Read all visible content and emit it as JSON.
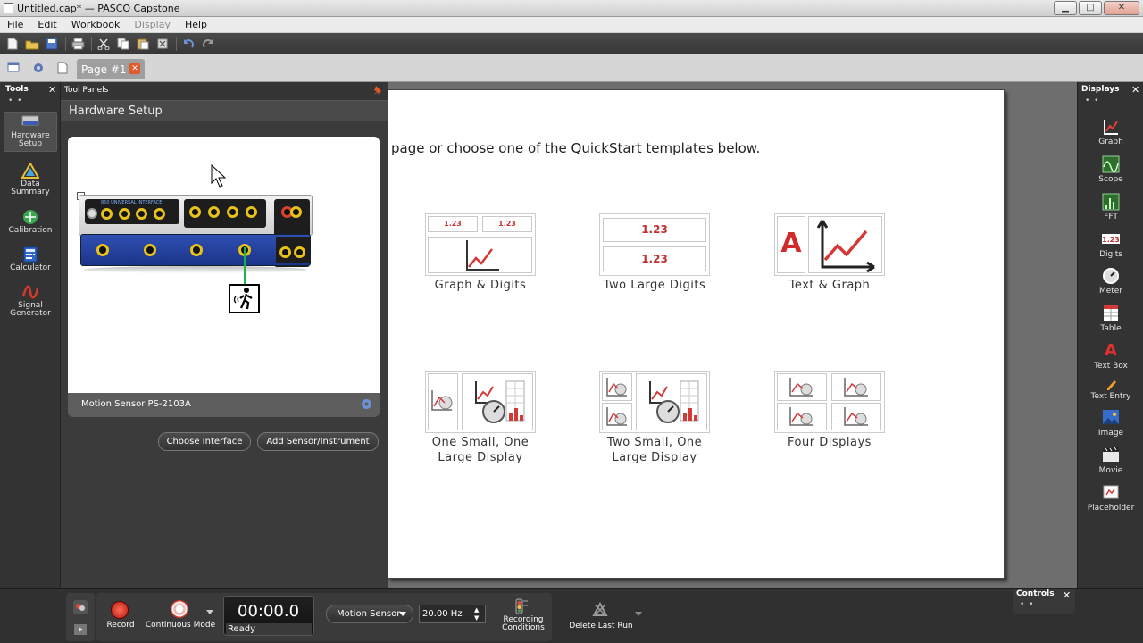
{
  "window": {
    "title": "Untitled.cap* — PASCO Capstone",
    "min": "▁",
    "max": "□",
    "close": "✕"
  },
  "menu": [
    {
      "label": "File",
      "enabled": true
    },
    {
      "label": "Edit",
      "enabled": true
    },
    {
      "label": "Workbook",
      "enabled": true
    },
    {
      "label": "Display",
      "enabled": false
    },
    {
      "label": "Help",
      "enabled": true
    }
  ],
  "tabs": {
    "active": "Page #1",
    "close": "✕"
  },
  "tools": {
    "title": "Tools",
    "close": "✕",
    "dots": "• •",
    "items": [
      {
        "label": "Hardware Setup",
        "icon": "hardware-icon"
      },
      {
        "label": "Data Summary",
        "icon": "data-summary-icon"
      },
      {
        "label": "Calibration",
        "icon": "calibration-icon"
      },
      {
        "label": "Calculator",
        "icon": "calculator-icon"
      },
      {
        "label": "Signal Generator",
        "icon": "signal-generator-icon"
      }
    ]
  },
  "tool_panels": {
    "header": "Tool Panels",
    "pin": "📌",
    "section_title": "Hardware Setup",
    "interface_brand": "850 UNIVERSAL INTERFACE",
    "sensor_label": "Motion Sensor PS-2103A",
    "choose_interface": "Choose Interface",
    "add_sensor": "Add Sensor/Instrument"
  },
  "page": {
    "intro": "page or choose one of the QuickStart templates below.",
    "templates": [
      {
        "label": "Graph & Digits",
        "digits": "1.23"
      },
      {
        "label": "Two Large Digits",
        "digits": "1.23"
      },
      {
        "label": "Text & Graph",
        "text_glyph": "A"
      },
      {
        "label": "One Small, One Large Display"
      },
      {
        "label": "Two Small, One Large Display"
      },
      {
        "label": "Four Displays"
      }
    ]
  },
  "displays": {
    "title": "Displays",
    "close": "✕",
    "dots": "• •",
    "items": [
      {
        "label": "Graph",
        "icon": "graph-icon"
      },
      {
        "label": "Scope",
        "icon": "scope-icon"
      },
      {
        "label": "FFT",
        "icon": "fft-icon"
      },
      {
        "label": "Digits",
        "icon": "digits-icon"
      },
      {
        "label": "Meter",
        "icon": "meter-icon"
      },
      {
        "label": "Table",
        "icon": "table-icon"
      },
      {
        "label": "Text Box",
        "icon": "text-box-icon"
      },
      {
        "label": "Text Entry",
        "icon": "text-entry-icon"
      },
      {
        "label": "Image",
        "icon": "image-icon"
      },
      {
        "label": "Movie",
        "icon": "movie-icon"
      },
      {
        "label": "Placeholder",
        "icon": "placeholder-icon"
      }
    ]
  },
  "controls": {
    "record": "Record",
    "mode": "Continuous Mode",
    "time": "00:00.0",
    "status": "Ready",
    "sensor_select": "Motion Sensor",
    "rate": "20.00 Hz",
    "recording_conditions": "Recording Conditions",
    "delete_last_run": "Delete Last Run",
    "panel_title": "Controls",
    "panel_close": "✕",
    "dots": "• •"
  },
  "colors": {
    "accent": "#e25a2a",
    "record": "#d62b1a",
    "wire": "#19b34a",
    "interface_front": "#1b3488"
  }
}
